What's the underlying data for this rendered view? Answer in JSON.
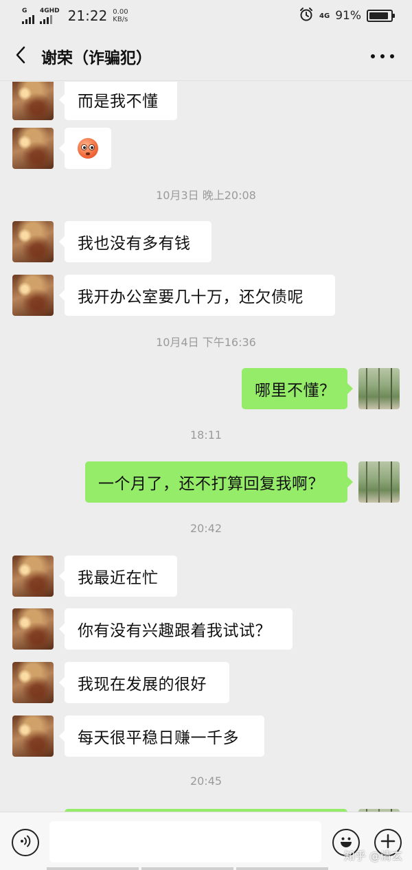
{
  "status_bar": {
    "sim1_label": "G",
    "sim2_label": "4GHD",
    "time": "21:22",
    "speed_value": "0.00",
    "speed_unit": "KB/s",
    "network": "4G",
    "battery_text": "91%",
    "battery_level": 0.91,
    "icons": [
      "signal-icon",
      "alarm-icon",
      "battery-icon"
    ]
  },
  "header": {
    "title": "谢荣（诈骗犯）",
    "back_icon": "chevron-left-icon",
    "more_icon": "more-dots-icon"
  },
  "messages": [
    {
      "type": "msg",
      "side": "left",
      "text": "而是我不懂"
    },
    {
      "type": "msg",
      "side": "left",
      "text": "",
      "emoji": "flushed-face-icon"
    },
    {
      "type": "time",
      "text": "10月3日 晚上20:08"
    },
    {
      "type": "msg",
      "side": "left",
      "text": "我也没有多有钱"
    },
    {
      "type": "msg",
      "side": "left",
      "text": "我开办公室要几十万，还欠债呢"
    },
    {
      "type": "time",
      "text": "10月4日 下午16:36"
    },
    {
      "type": "msg",
      "side": "right",
      "text": "哪里不懂？"
    },
    {
      "type": "time",
      "text": "18:11"
    },
    {
      "type": "msg",
      "side": "right",
      "text": "一个月了，还不打算回复我啊？"
    },
    {
      "type": "time",
      "text": "20:42"
    },
    {
      "type": "msg",
      "side": "left",
      "text": "我最近在忙"
    },
    {
      "type": "msg",
      "side": "left",
      "text": "你有没有兴趣跟着我试试？"
    },
    {
      "type": "msg",
      "side": "left",
      "text": "我现在发展的很好"
    },
    {
      "type": "msg",
      "side": "left",
      "text": "每天很平稳日赚一千多"
    },
    {
      "type": "time",
      "text": "20:45"
    }
  ],
  "input_bar": {
    "value": "",
    "voice_icon": "voice-icon",
    "emoji_icon": "emoji-icon",
    "plus_icon": "plus-icon"
  },
  "watermark": "知乎 @清玄",
  "colors": {
    "background": "#ededed",
    "bubble_left": "#ffffff",
    "bubble_right": "#95ec69",
    "timestamp": "#9a9a9a"
  }
}
